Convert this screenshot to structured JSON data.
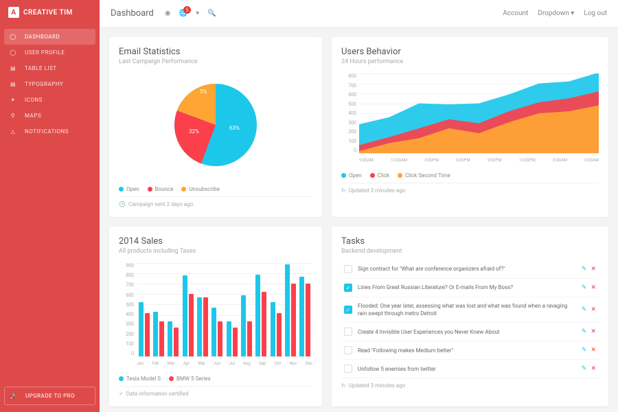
{
  "brand": "CREATIVE TIM",
  "sidebar": {
    "items": [
      {
        "label": "DASHBOARD",
        "icon": "dashboard-icon",
        "active": true
      },
      {
        "label": "USER PROFILE",
        "icon": "user-icon"
      },
      {
        "label": "TABLE LIST",
        "icon": "table-icon"
      },
      {
        "label": "TYPOGRAPHY",
        "icon": "typography-icon"
      },
      {
        "label": "ICONS",
        "icon": "icons-icon"
      },
      {
        "label": "MAPS",
        "icon": "maps-icon"
      },
      {
        "label": "NOTIFICATIONS",
        "icon": "bell-icon"
      }
    ],
    "upgrade": "UPGRADE TO PRO"
  },
  "topbar": {
    "title": "Dashboard",
    "notif_count": "5",
    "links": [
      "Account",
      "Dropdown",
      "Log out"
    ]
  },
  "cards": {
    "email": {
      "title": "Email Statistics",
      "sub": "Last Campaign Performance",
      "legend": [
        "Open",
        "Bounce",
        "Unsubscribe"
      ],
      "footer": "Campaign sent 2 days ago"
    },
    "behavior": {
      "title": "Users Behavior",
      "sub": "24 Hours performance",
      "legend": [
        "Open",
        "Click",
        "Click Second Time"
      ],
      "footer": "Updated 3 minutes ago"
    },
    "sales": {
      "title": "2014 Sales",
      "sub": "All products including Taxes",
      "legend": [
        "Tesla Model S",
        "BMW 5 Series"
      ],
      "footer": "Data information certified"
    },
    "tasks": {
      "title": "Tasks",
      "sub": "Backend development",
      "footer": "Updated 3 minutes ago"
    }
  },
  "tasks": [
    {
      "text": "Sign contract for \"What are conference organizers afraid of?\"",
      "checked": false
    },
    {
      "text": "Lines From Great Russian Literature? Or E-mails From My Boss?",
      "checked": true
    },
    {
      "text": "Flooded: One year later, assessing what was lost and what was found when a ravaging rain swept through metro Detroit",
      "checked": true
    },
    {
      "text": "Create 4 Invisible User Experiences you Never Knew About",
      "checked": false
    },
    {
      "text": "Read \"Following makes Medium better\"",
      "checked": false
    },
    {
      "text": "Unfollow 5 enemies from twitter",
      "checked": false
    }
  ],
  "colors": {
    "cyan": "#1dc7ea",
    "red": "#fb404b",
    "orange": "#ffa534"
  },
  "chart_data": [
    {
      "id": "email_pie",
      "type": "pie",
      "title": "Email Statistics",
      "series": [
        {
          "name": "Open",
          "value": 63,
          "color": "#1dc7ea"
        },
        {
          "name": "Bounce",
          "value": 32,
          "color": "#fb404b"
        },
        {
          "name": "Unsubscribe",
          "value": 5,
          "color": "#ffa534"
        }
      ],
      "labels": [
        "63%",
        "32%",
        "5%"
      ]
    },
    {
      "id": "behavior_area",
      "type": "area",
      "title": "Users Behavior",
      "x": [
        "9:00AM",
        "12:00AM",
        "3:00PM",
        "6:00PM",
        "9:00PM",
        "12:00PM",
        "3:00AM",
        "6:00AM"
      ],
      "ylim": [
        0,
        800
      ],
      "yticks": [
        0,
        100,
        200,
        300,
        400,
        500,
        600,
        700,
        800
      ],
      "series": [
        {
          "name": "Open",
          "color": "#1dc7ea",
          "values": [
            290,
            360,
            500,
            490,
            500,
            590,
            700,
            720,
            810
          ]
        },
        {
          "name": "Click",
          "color": "#fb404b",
          "values": [
            80,
            160,
            250,
            340,
            300,
            420,
            510,
            550,
            620
          ]
        },
        {
          "name": "Click Second Time",
          "color": "#ffa534",
          "values": [
            20,
            100,
            150,
            250,
            200,
            310,
            400,
            420,
            480
          ]
        }
      ]
    },
    {
      "id": "sales_bar",
      "type": "bar",
      "title": "2014 Sales",
      "categories": [
        "Jan",
        "Feb",
        "Mar",
        "Apr",
        "Mai",
        "Jun",
        "Jul",
        "Aug",
        "Sep",
        "Oct",
        "Nov",
        "Dec"
      ],
      "ylim": [
        0,
        900
      ],
      "yticks": [
        0,
        100,
        200,
        300,
        400,
        500,
        600,
        700,
        800,
        900
      ],
      "series": [
        {
          "name": "Tesla Model S",
          "color": "#1dc7ea",
          "values": [
            520,
            430,
            340,
            780,
            570,
            470,
            340,
            590,
            790,
            520,
            890,
            770
          ]
        },
        {
          "name": "BMW 5 Series",
          "color": "#fb404b",
          "values": [
            420,
            340,
            280,
            600,
            570,
            340,
            280,
            340,
            620,
            420,
            700,
            700
          ]
        }
      ]
    }
  ]
}
